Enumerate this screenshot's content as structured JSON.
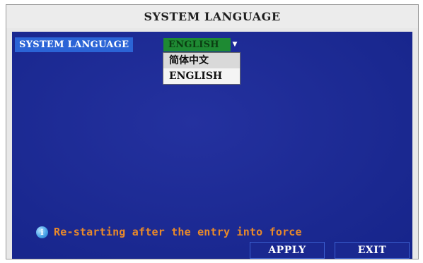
{
  "window": {
    "title": "SYSTEM LANGUAGE"
  },
  "settings": {
    "language_label": "SYSTEM LANGUAGE",
    "language_selected": "ENGLISH",
    "dropdown_arrow": "▼",
    "language_options": [
      "简体中文",
      "ENGLISH"
    ]
  },
  "hint": {
    "icon": "info-bubble-icon",
    "text": "Re-starting after the entry into force"
  },
  "buttons": {
    "apply_label": "APPLY",
    "exit_label": "EXIT"
  },
  "colors": {
    "panel_background": "#1c2a98",
    "label_highlight": "#2b64d6",
    "selected_value_background": "#1e8a33",
    "hint_text": "#e8892a"
  }
}
